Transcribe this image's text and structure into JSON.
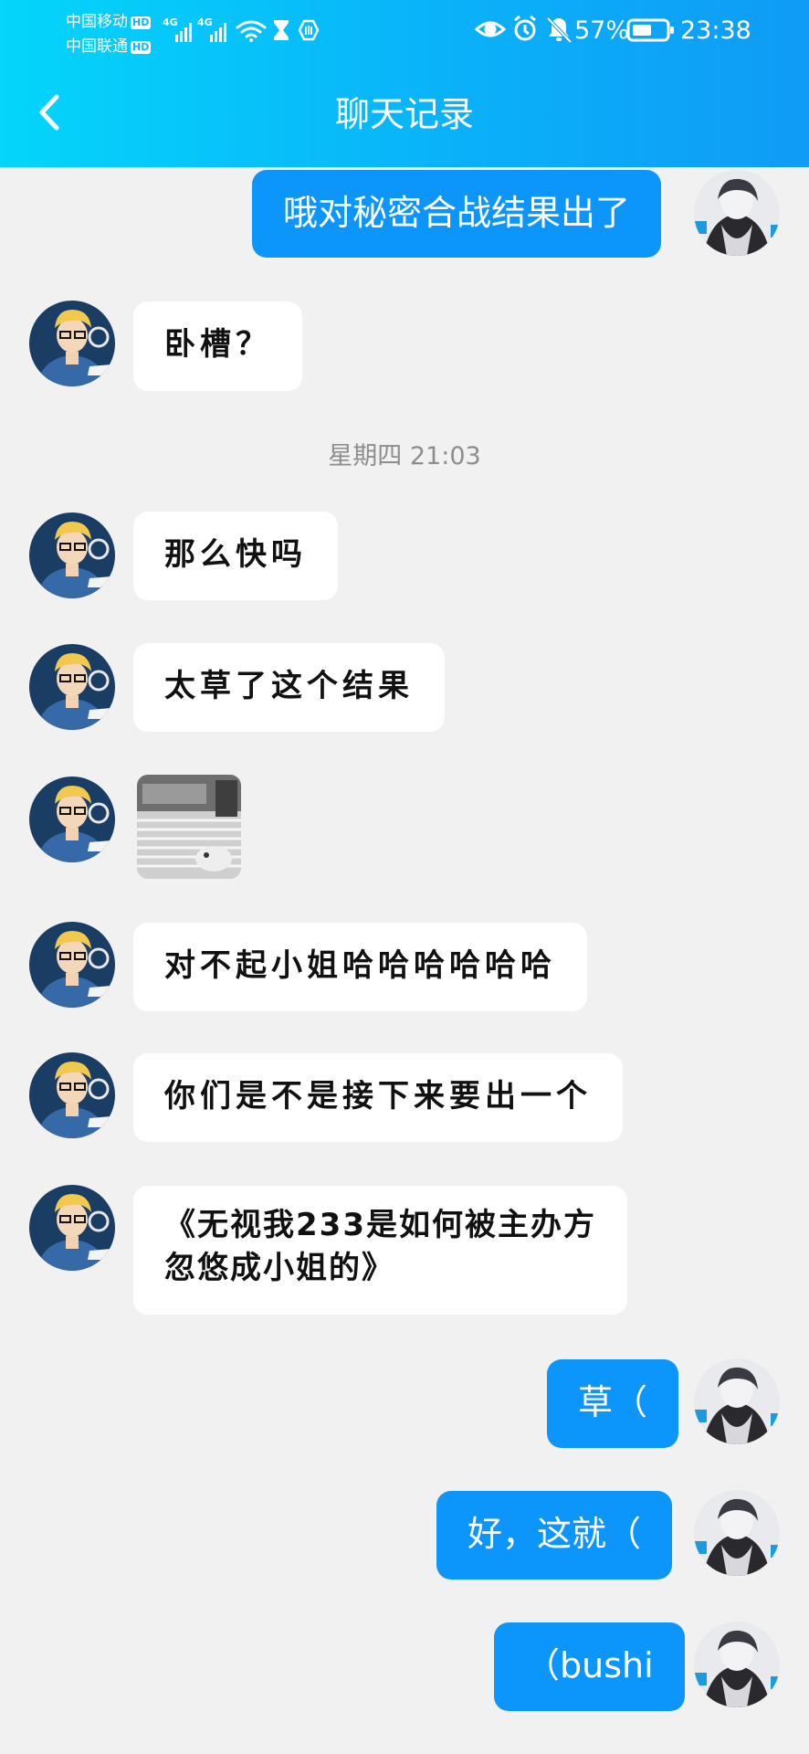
{
  "status_bar": {
    "carrier_1": "中国移动",
    "carrier_2": "中国联通",
    "hd_badge": "HD",
    "network_1": "4G",
    "network_2": "4G",
    "battery_percent": "57%",
    "time": "23:38",
    "icons": [
      "signal-icon",
      "signal-icon",
      "wifi-icon",
      "hourglass-icon",
      "hand-icon",
      "eye-icon",
      "alarm-icon",
      "bell-off-icon",
      "battery-icon"
    ]
  },
  "header": {
    "title": "聊天记录",
    "back_icon": "chevron-left-icon",
    "background_gradient": [
      "#04d5fa",
      "#0f9bf6"
    ]
  },
  "colors": {
    "page_bg": "#f1f1f1",
    "outgoing_bubble": "#0c96fc",
    "incoming_bubble": "#ffffff",
    "timestamp_text": "#8d8d8d"
  },
  "messages": [
    {
      "sender": "me",
      "text": "哦对秘密合战结果出了"
    },
    {
      "sender": "friend",
      "text": "卧槽？"
    },
    {
      "sender": "friend",
      "text": "那么快吗"
    },
    {
      "sender": "friend",
      "text": "太草了这个结果"
    },
    {
      "sender": "friend",
      "type": "image"
    },
    {
      "sender": "friend",
      "text": "对不起小姐哈哈哈哈哈哈"
    },
    {
      "sender": "friend",
      "text": "你们是不是接下来要出一个"
    },
    {
      "sender": "friend",
      "lines": [
        "《无视我233是如何被主办方",
        "忽悠成小姐的》"
      ]
    },
    {
      "sender": "me",
      "text": "草（"
    },
    {
      "sender": "me",
      "text": "好，这就（"
    },
    {
      "sender": "me",
      "text": "（bushi"
    }
  ],
  "timestamp": "星期四 21:03"
}
